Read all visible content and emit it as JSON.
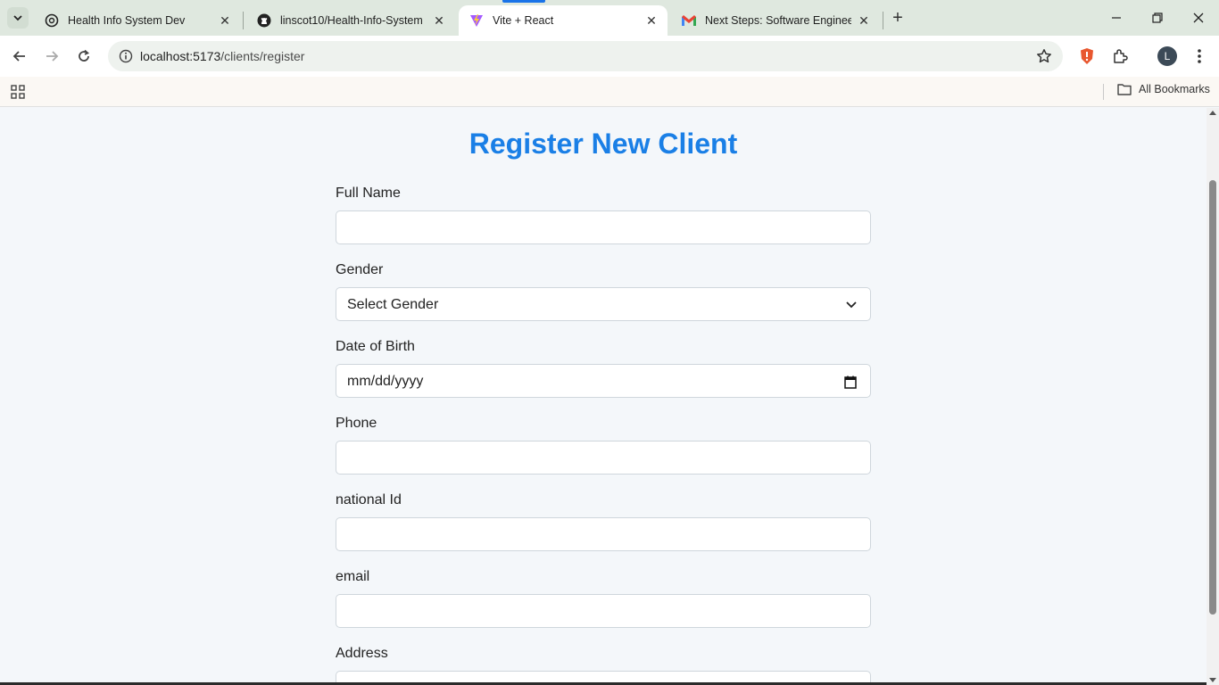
{
  "browser": {
    "tabs": [
      {
        "title": "Health Info System Dev",
        "favicon": "openai-icon",
        "active": false
      },
      {
        "title": "linscot10/Health-Info-System",
        "favicon": "github-icon",
        "active": false
      },
      {
        "title": "Vite + React",
        "favicon": "vite-icon",
        "active": true
      },
      {
        "title": "Next Steps: Software Engineerin",
        "favicon": "gmail-icon",
        "active": false
      }
    ],
    "url_host": "localhost:5173",
    "url_path": "/clients/register",
    "profile_initial": "L",
    "bookmarks_label": "All Bookmarks",
    "accent": "#1a73e8"
  },
  "page": {
    "title": "Register New Client",
    "title_color": "#1a7fe6",
    "fields": [
      {
        "label": "Full Name",
        "type": "text",
        "value": ""
      },
      {
        "label": "Gender",
        "type": "select",
        "value": "Select Gender"
      },
      {
        "label": "Date of Birth",
        "type": "date",
        "value": "mm/dd/yyyy"
      },
      {
        "label": "Phone",
        "type": "text",
        "value": ""
      },
      {
        "label": "national Id",
        "type": "text",
        "value": ""
      },
      {
        "label": "email",
        "type": "text",
        "value": ""
      },
      {
        "label": "Address",
        "type": "text",
        "value": ""
      }
    ]
  }
}
